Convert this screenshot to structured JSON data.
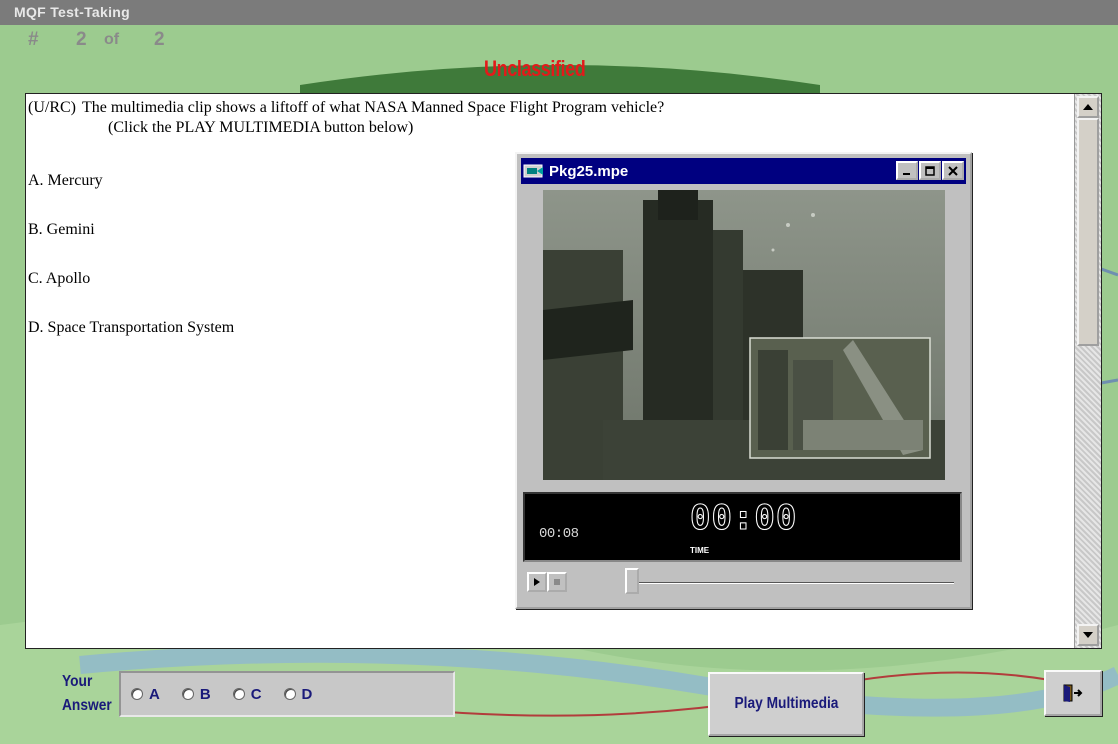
{
  "window": {
    "title": "MQF Test-Taking"
  },
  "header": {
    "hash": "#",
    "current": "2",
    "of_label": "of",
    "total": "2",
    "classification": "Unclassified"
  },
  "question": {
    "tag": "(U/RC)",
    "text": "The multimedia clip shows a liftoff of what NASA Manned Space Flight Program vehicle?",
    "instruction": "(Click the PLAY MULTIMEDIA button below)",
    "choices": [
      "A.  Mercury",
      "B.  Gemini",
      "C.  Apollo",
      "D.  Space Transportation System"
    ]
  },
  "player": {
    "title": "Pkg25.mpe",
    "elapsed": "00:08",
    "big_time": "00:00",
    "time_label": "TIME",
    "position_fraction": 0.0
  },
  "answer": {
    "label_line1": "Your",
    "label_line2": "Answer",
    "options": [
      "A",
      "B",
      "C",
      "D"
    ]
  },
  "buttons": {
    "play_multimedia": "Play Multimedia"
  },
  "colors": {
    "classification": "#e31a1a",
    "answer_text": "#1a1a7a",
    "player_titlebar": "#000080"
  }
}
